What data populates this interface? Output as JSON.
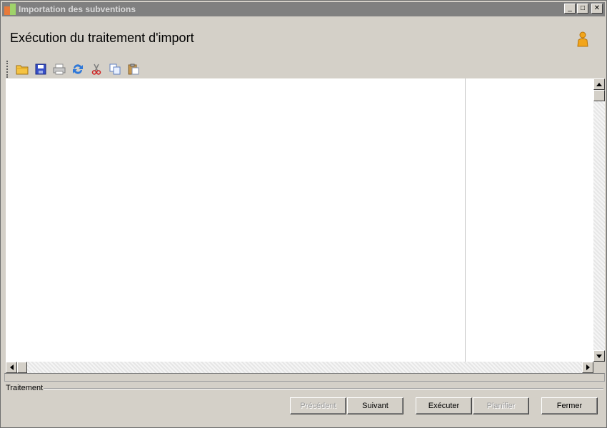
{
  "window": {
    "title": "Importation des subventions",
    "minimize_label": "_",
    "maximize_label": "□",
    "close_label": "✕"
  },
  "header": {
    "title": "Exécution du traitement d'import",
    "icon": "person-icon"
  },
  "toolbar": {
    "items": [
      "open-folder-icon",
      "save-icon",
      "print-icon",
      "refresh-icon",
      "cut-icon",
      "copy-icon",
      "paste-icon"
    ]
  },
  "group": {
    "label": "Traitement"
  },
  "buttons": {
    "previous": "Précédent",
    "next": "Suivant",
    "execute": "Exécuter",
    "schedule": "Planifier",
    "close": "Fermer"
  },
  "colors": {
    "titlebar": "#808080",
    "background": "#d4d0c8",
    "disabled_text": "#9a9a9a"
  }
}
